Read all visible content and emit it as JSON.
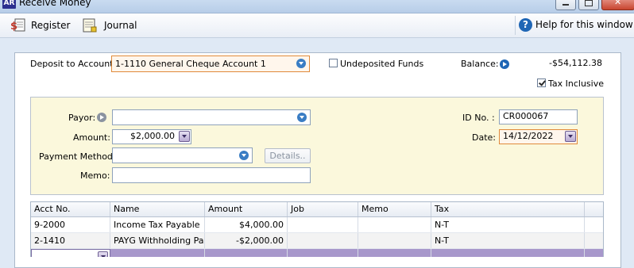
{
  "window": {
    "app_logo": "AR",
    "title": "Receive Money"
  },
  "toolbar": {
    "register": "Register",
    "journal": "Journal",
    "help": "Help for this window"
  },
  "header": {
    "deposit_label": "Deposit to Account:",
    "deposit_value": "1-1110 General Cheque Account 1",
    "undeposited_label": "Undeposited Funds",
    "undeposited_checked": false,
    "balance_label": "Balance:",
    "balance_value": "-$54,112.38",
    "tax_inclusive_label": "Tax Inclusive",
    "tax_inclusive_checked": true
  },
  "payment": {
    "payor_label": "Payor:",
    "payor_value": "",
    "amount_label": "Amount:",
    "amount_value": "$2,000.00",
    "method_label": "Payment Method:",
    "method_value": "",
    "details_label": "Details..",
    "memo_label": "Memo:",
    "memo_value": "",
    "id_label": "ID No. :",
    "id_value": "CR000067",
    "date_label": "Date:",
    "date_value": "14/12/2022"
  },
  "grid": {
    "columns": [
      "Acct No.",
      "Name",
      "Amount",
      "Job",
      "Memo",
      "Tax"
    ],
    "rows": [
      [
        "9-2000",
        "Income Tax Payable",
        "$4,000.00",
        "",
        "",
        "N-T"
      ],
      [
        "2-1410",
        "PAYG Withholding Paya",
        "-$2,000.00",
        "",
        "",
        "N-T"
      ]
    ]
  },
  "colors": {
    "accent": "#1f66b5",
    "highlight_field": "#e08a3a",
    "panel_yellow": "#fbf8dc",
    "selected_row": "#a797cb"
  }
}
